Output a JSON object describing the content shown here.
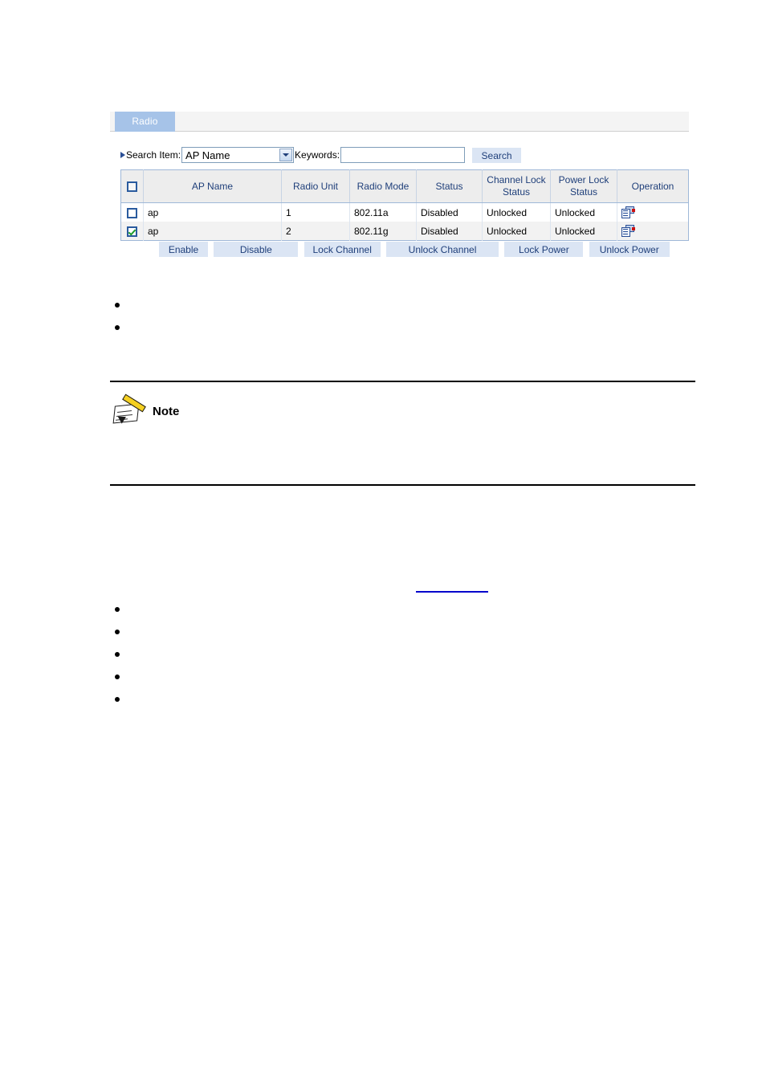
{
  "figure": {
    "tab": {
      "label": "Radio"
    },
    "search": {
      "arrow_icon": "triangle-right-icon",
      "item_label": "Search Item:",
      "selected_option": "AP Name",
      "options": [
        "AP Name"
      ],
      "dropdown_icon": "chevron-down-icon",
      "keywords_label": "Keywords:",
      "keywords_value": "",
      "keywords_placeholder": "",
      "search_button": "Search"
    },
    "table": {
      "select_all_checked": false,
      "columns": [
        "",
        "AP Name",
        "Radio Unit",
        "Radio Mode",
        "Status",
        "Channel Lock Status",
        "Power Lock Status",
        "Operation"
      ],
      "rows": [
        {
          "checked": false,
          "ap_name": "ap",
          "radio_unit": "1",
          "radio_mode": "802.11a",
          "status": "Disabled",
          "channel_lock_status": "Unlocked",
          "power_lock_status": "Unlocked",
          "operation_icon": "properties-icon"
        },
        {
          "checked": true,
          "ap_name": "ap",
          "radio_unit": "2",
          "radio_mode": "802.11g",
          "status": "Disabled",
          "channel_lock_status": "Unlocked",
          "power_lock_status": "Unlocked",
          "operation_icon": "properties-icon"
        }
      ]
    },
    "actions": [
      "Enable",
      "Disable",
      "Lock Channel",
      "Unlock Channel",
      "Lock Power",
      "Unlock Power"
    ]
  },
  "document": {
    "bullets_top": [
      "",
      ""
    ],
    "bullets_bottom": [
      "",
      "",
      "",
      "",
      ""
    ],
    "note": {
      "icon": "note-pencil-icon",
      "label": "Note"
    },
    "cross_reference": {
      "text": ""
    }
  },
  "colors": {
    "tab_bg": "#a6c3e8",
    "tab_text": "#ffffff",
    "header_bg": "#ededed",
    "header_text": "#1f3f7a",
    "table_border": "#9fb8d8",
    "button_bg": "#dbe5f4",
    "button_text": "#1f3f7a",
    "row_alt_bg": "#f2f2f2",
    "checkbox_border": "#2a5b9e",
    "check_mark": "#1f9d2f",
    "link": "#0000cc",
    "note_rule": "#000000"
  }
}
